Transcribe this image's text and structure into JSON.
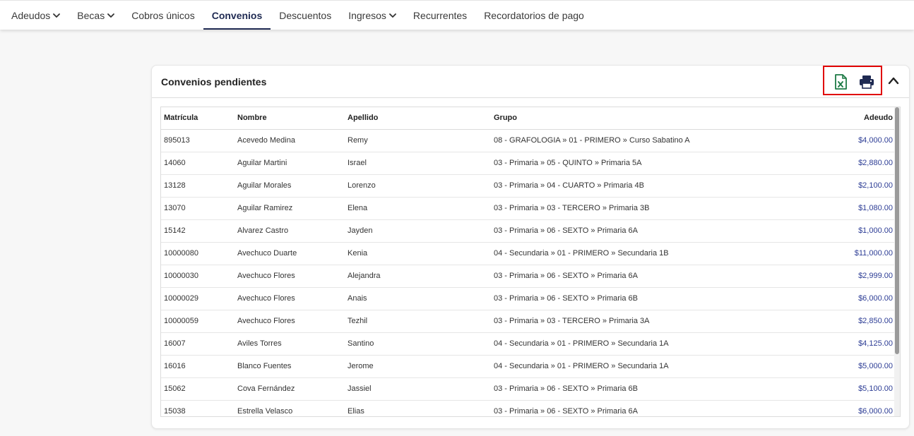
{
  "nav": {
    "items": [
      {
        "label": "Adeudos",
        "dropdown": true,
        "active": false
      },
      {
        "label": "Becas",
        "dropdown": true,
        "active": false
      },
      {
        "label": "Cobros únicos",
        "dropdown": false,
        "active": false
      },
      {
        "label": "Convenios",
        "dropdown": false,
        "active": true
      },
      {
        "label": "Descuentos",
        "dropdown": false,
        "active": false
      },
      {
        "label": "Ingresos",
        "dropdown": true,
        "active": false
      },
      {
        "label": "Recurrentes",
        "dropdown": false,
        "active": false
      },
      {
        "label": "Recordatorios de pago",
        "dropdown": false,
        "active": false
      }
    ]
  },
  "card": {
    "title": "Convenios pendientes",
    "icons": {
      "excel": "excel-export-icon",
      "print": "printer-icon",
      "collapse": "chevron-up-icon"
    },
    "colors": {
      "excel": "#1d7a45",
      "print": "#1f2a52",
      "highlight": "#e00000",
      "amount": "#2d3d95"
    }
  },
  "table": {
    "headers": {
      "matricula": "Matrícula",
      "nombre": "Nombre",
      "apellido": "Apellido",
      "grupo": "Grupo",
      "adeudo": "Adeudo"
    },
    "rows": [
      {
        "matricula": "895013",
        "nombre": "Acevedo Medina",
        "apellido": "Remy",
        "grupo": "08 - GRAFOLOGIA » 01 - PRIMERO » Curso Sabatino A",
        "adeudo": "$4,000.00"
      },
      {
        "matricula": "14060",
        "nombre": "Aguilar Martini",
        "apellido": "Israel",
        "grupo": "03 - Primaria » 05 - QUINTO » Primaria 5A",
        "adeudo": "$2,880.00"
      },
      {
        "matricula": "13128",
        "nombre": "Aguilar Morales",
        "apellido": "Lorenzo",
        "grupo": "03 - Primaria » 04 - CUARTO » Primaria 4B",
        "adeudo": "$2,100.00"
      },
      {
        "matricula": "13070",
        "nombre": "Aguilar Ramirez",
        "apellido": "Elena",
        "grupo": "03 - Primaria » 03 - TERCERO » Primaria 3B",
        "adeudo": "$1,080.00"
      },
      {
        "matricula": "15142",
        "nombre": "Alvarez Castro",
        "apellido": "Jayden",
        "grupo": "03 - Primaria » 06 - SEXTO » Primaria 6A",
        "adeudo": "$1,000.00"
      },
      {
        "matricula": "10000080",
        "nombre": "Avechuco Duarte",
        "apellido": "Kenia",
        "grupo": "04 - Secundaria » 01 - PRIMERO » Secundaria 1B",
        "adeudo": "$11,000.00"
      },
      {
        "matricula": "10000030",
        "nombre": "Avechuco Flores",
        "apellido": "Alejandra",
        "grupo": "03 - Primaria » 06 - SEXTO » Primaria 6A",
        "adeudo": "$2,999.00"
      },
      {
        "matricula": "10000029",
        "nombre": "Avechuco Flores",
        "apellido": "Anais",
        "grupo": "03 - Primaria » 06 - SEXTO » Primaria 6B",
        "adeudo": "$6,000.00"
      },
      {
        "matricula": "10000059",
        "nombre": "Avechuco Flores",
        "apellido": "Tezhil",
        "grupo": "03 - Primaria » 03 - TERCERO » Primaria 3A",
        "adeudo": "$2,850.00"
      },
      {
        "matricula": "16007",
        "nombre": "Aviles Torres",
        "apellido": "Santino",
        "grupo": "04 - Secundaria » 01 - PRIMERO » Secundaria 1A",
        "adeudo": "$4,125.00"
      },
      {
        "matricula": "16016",
        "nombre": "Blanco Fuentes",
        "apellido": "Jerome",
        "grupo": "04 - Secundaria » 01 - PRIMERO » Secundaria 1A",
        "adeudo": "$5,000.00"
      },
      {
        "matricula": "15062",
        "nombre": "Cova Fernández",
        "apellido": "Jassiel",
        "grupo": "03 - Primaria » 06 - SEXTO » Primaria 6B",
        "adeudo": "$5,100.00"
      },
      {
        "matricula": "15038",
        "nombre": "Estrella Velasco",
        "apellido": "Elias",
        "grupo": "03 - Primaria » 06 - SEXTO » Primaria 6A",
        "adeudo": "$6,000.00"
      }
    ]
  }
}
